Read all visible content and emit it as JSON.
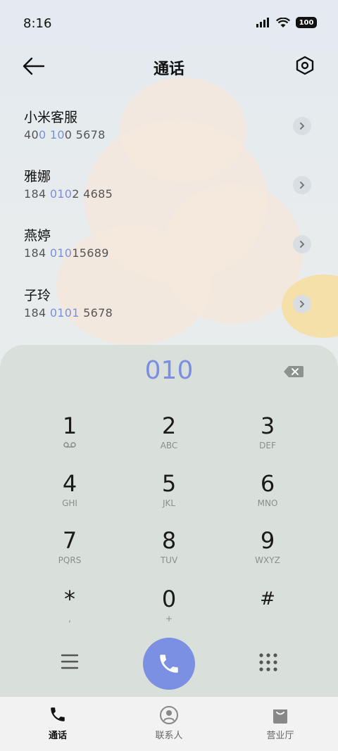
{
  "status_bar": {
    "time": "8:16",
    "battery": "100",
    "icons": [
      "signal-icon",
      "wifi-icon",
      "battery-icon"
    ]
  },
  "header": {
    "title": "通话",
    "back_icon": "back-arrow-icon",
    "settings_icon": "settings-hexagon-icon"
  },
  "contacts": [
    {
      "name": "小米客服",
      "number_parts": [
        "40",
        "0 10",
        "0 5678"
      ]
    },
    {
      "name": "雅娜",
      "number_parts": [
        "184 ",
        "010",
        "2 4685"
      ]
    },
    {
      "name": "燕婷",
      "number_parts": [
        "184 ",
        "010",
        "15689"
      ]
    },
    {
      "name": "子玲",
      "number_parts": [
        "184 ",
        "0101",
        " 5678"
      ]
    }
  ],
  "dialpad": {
    "input": "010",
    "keys": [
      {
        "digit": "1",
        "letters": ""
      },
      {
        "digit": "2",
        "letters": "ABC"
      },
      {
        "digit": "3",
        "letters": "DEF"
      },
      {
        "digit": "4",
        "letters": "GHI"
      },
      {
        "digit": "5",
        "letters": "JKL"
      },
      {
        "digit": "6",
        "letters": "MNO"
      },
      {
        "digit": "7",
        "letters": "PQRS"
      },
      {
        "digit": "8",
        "letters": "TUV"
      },
      {
        "digit": "9",
        "letters": "WXYZ"
      },
      {
        "digit": "*",
        "letters": ","
      },
      {
        "digit": "0",
        "letters": "+"
      },
      {
        "digit": "#",
        "letters": ""
      }
    ]
  },
  "tabs": [
    {
      "label": "通话",
      "icon": "phone-icon",
      "active": true
    },
    {
      "label": "联系人",
      "icon": "contact-person-icon",
      "active": false
    },
    {
      "label": "营业厅",
      "icon": "shopping-bag-icon",
      "active": false
    }
  ],
  "colors": {
    "accent": "#7b8fe0",
    "call_button": "#7b90e3",
    "dialpad_bg": "#d9dfdb"
  }
}
